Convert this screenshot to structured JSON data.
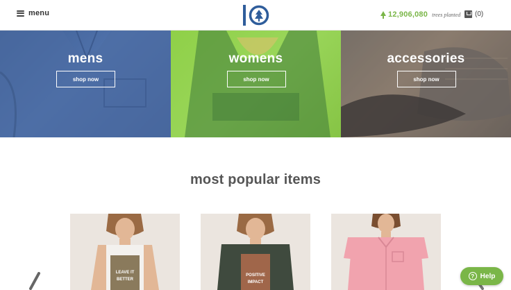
{
  "header": {
    "menu_label": "menu",
    "logo_icon": "tentree-logo",
    "trees_count": "12,906,080",
    "trees_label": "trees planted",
    "cart_count": "(0)"
  },
  "categories": [
    {
      "title": "mens",
      "button": "shop now",
      "color": "#4a6aa3"
    },
    {
      "title": "womens",
      "button": "shop now",
      "color": "#93d250"
    },
    {
      "title": "accessories",
      "button": "shop now",
      "color": "#7a706a"
    }
  ],
  "popular": {
    "title": "most popular items",
    "items": [
      {
        "print": "LEAVE IT BETTER",
        "icon": "tank-top-product-image"
      },
      {
        "print": "POSITIVE IMPACT",
        "icon": "tshirt-product-image"
      },
      {
        "print": "",
        "icon": "button-shirt-product-image"
      }
    ]
  },
  "help": {
    "label": "Help"
  },
  "colors": {
    "accent": "#7ab648",
    "text": "#555555"
  }
}
